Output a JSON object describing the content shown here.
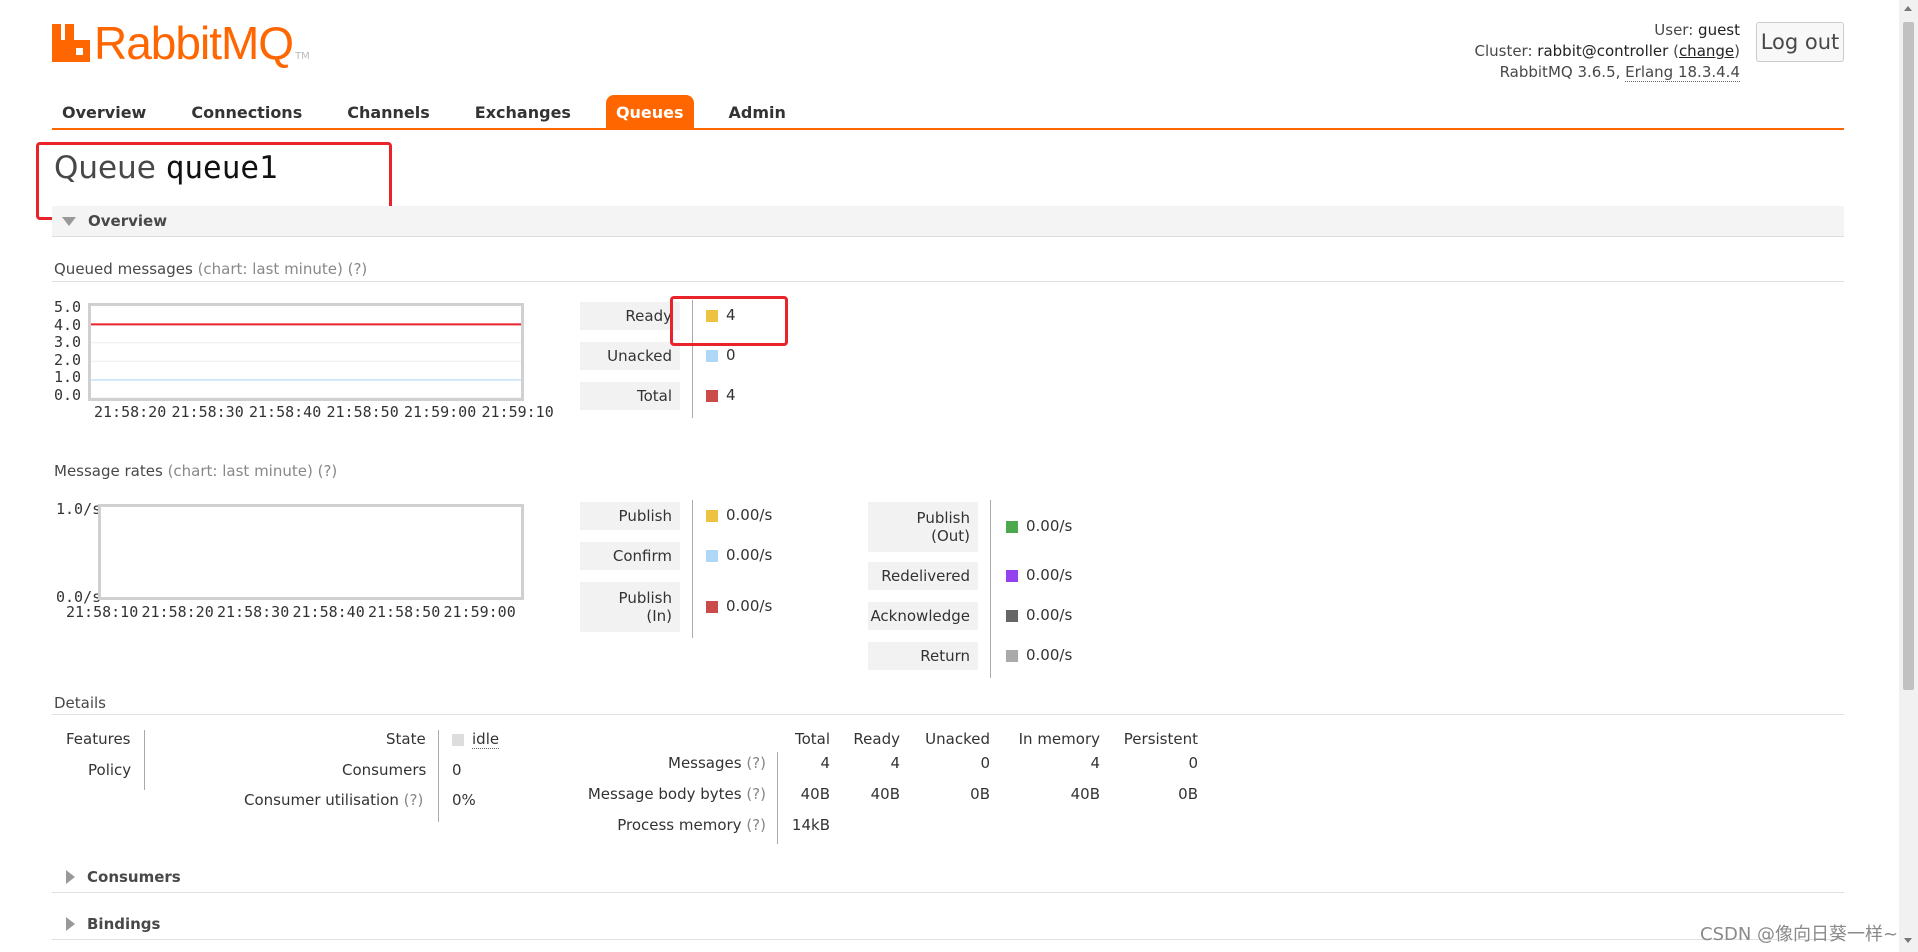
{
  "header": {
    "logo_text": "RabbitMQ",
    "logo_tm": "TM",
    "user_label": "User:",
    "user_value": "guest",
    "cluster_label": "Cluster:",
    "cluster_value": "rabbit@controller",
    "cluster_change": "change",
    "version": "RabbitMQ 3.6.5,",
    "erlang": "Erlang 18.3.4.4",
    "logout_label": "Log out"
  },
  "nav": {
    "tabs": [
      {
        "label": "Overview"
      },
      {
        "label": "Connections"
      },
      {
        "label": "Channels"
      },
      {
        "label": "Exchanges"
      },
      {
        "label": "Queues",
        "active": true
      },
      {
        "label": "Admin"
      }
    ]
  },
  "page": {
    "title_prefix": "Queue",
    "queue_name": "queue1"
  },
  "overview": {
    "section_label": "Overview",
    "queued": {
      "title": "Queued messages",
      "meta": "(chart: last minute)",
      "help": "(?)",
      "y_ticks": [
        "5.0",
        "4.0",
        "3.0",
        "2.0",
        "1.0",
        "0.0"
      ],
      "x_ticks": [
        "21:58:20",
        "21:58:30",
        "21:58:40",
        "21:58:50",
        "21:59:00",
        "21:59:10"
      ],
      "line_value": 4,
      "y_max": 5,
      "legend": [
        {
          "label": "Ready",
          "value": "4",
          "color": "#edc240"
        },
        {
          "label": "Unacked",
          "value": "0",
          "color": "#afd8f8"
        },
        {
          "label": "Total",
          "value": "4",
          "color": "#cb4b4b"
        }
      ],
      "total_color": "#e8232a"
    },
    "rates": {
      "title": "Message rates",
      "meta": "(chart: last minute)",
      "help": "(?)",
      "y_ticks": [
        "1.0/s",
        "0.0/s"
      ],
      "x_ticks": [
        "21:58:10",
        "21:58:20",
        "21:58:30",
        "21:58:40",
        "21:58:50",
        "21:59:00"
      ],
      "legend_left": [
        {
          "label": "Publish",
          "value": "0.00/s",
          "color": "#edc240"
        },
        {
          "label": "Confirm",
          "value": "0.00/s",
          "color": "#afd8f8"
        },
        {
          "label_line1": "Publish",
          "label_line2": "(In)",
          "value": "0.00/s",
          "color": "#cb4b4b"
        }
      ],
      "legend_right": [
        {
          "label_line1": "Publish",
          "label_line2": "(Out)",
          "value": "0.00/s",
          "color": "#4da74d"
        },
        {
          "label": "Redelivered",
          "value": "0.00/s",
          "color": "#9440ed"
        },
        {
          "label": "Acknowledge",
          "value": "0.00/s",
          "color": "#666666"
        },
        {
          "label": "Return",
          "value": "0.00/s",
          "color": "#aaaaaa"
        }
      ]
    }
  },
  "details": {
    "title": "Details",
    "features_label": "Features",
    "policy_label": "Policy",
    "state_label": "State",
    "state_value": "idle",
    "consumers_label": "Consumers",
    "consumers_value": "0",
    "util_label": "Consumer utilisation",
    "util_help": "(?)",
    "util_value": "0%",
    "cols": [
      "Total",
      "Ready",
      "Unacked",
      "In memory",
      "Persistent"
    ],
    "rows": [
      {
        "label": "Messages",
        "help": "(?)",
        "values": [
          "4",
          "4",
          "0",
          "4",
          "0"
        ]
      },
      {
        "label": "Message body bytes",
        "help": "(?)",
        "values": [
          "40B",
          "40B",
          "0B",
          "40B",
          "0B"
        ]
      },
      {
        "label": "Process memory",
        "help": "(?)",
        "values": [
          "14kB",
          "",
          "",
          "",
          ""
        ]
      }
    ]
  },
  "sections": {
    "consumers": "Consumers",
    "bindings": "Bindings"
  },
  "watermark": "CSDN @像向日葵一样~"
}
